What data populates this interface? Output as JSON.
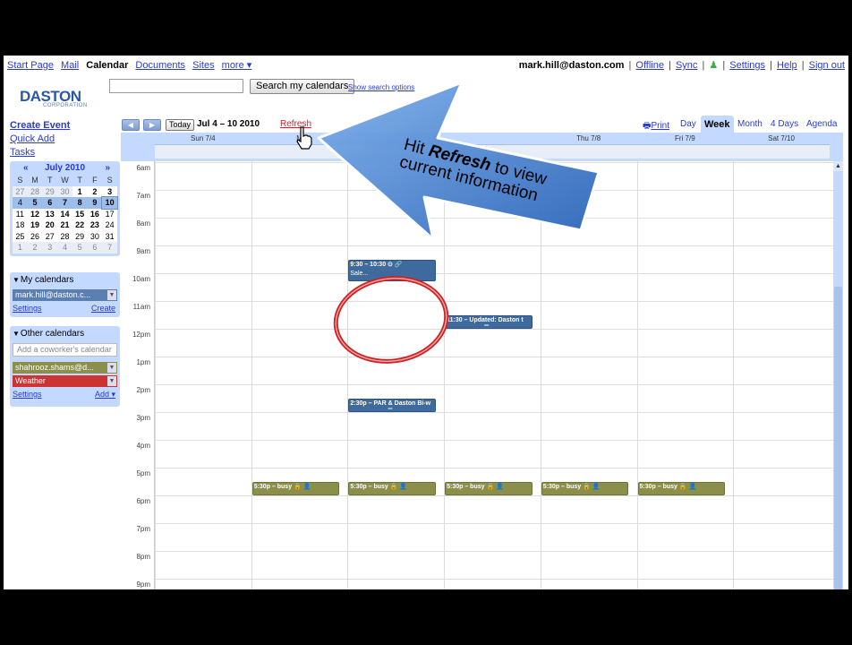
{
  "topnav": {
    "left": [
      {
        "label": "Start Page",
        "current": false
      },
      {
        "label": "Mail",
        "current": false
      },
      {
        "label": "Calendar",
        "current": true
      },
      {
        "label": "Documents",
        "current": false
      },
      {
        "label": "Sites",
        "current": false
      },
      {
        "label": "more ▾",
        "current": false
      }
    ],
    "email": "mark.hill@daston.com",
    "right": [
      "Offline",
      "Sync",
      "Settings",
      "Help",
      "Sign out"
    ]
  },
  "header": {
    "logo_text": "DASTON",
    "logo_sub": "CORPORATION",
    "search_button": "Search my calendars",
    "show_options": "Show search options"
  },
  "sidebar": {
    "create_event": "Create Event",
    "quick_add": "Quick Add",
    "tasks": "Tasks",
    "minical": {
      "month": "July 2010",
      "prev": "«",
      "next": "»",
      "weekdays": [
        "S",
        "M",
        "T",
        "W",
        "T",
        "F",
        "S"
      ],
      "weeks": [
        [
          "27",
          "28",
          "29",
          "30",
          "1",
          "2",
          "3"
        ],
        [
          "4",
          "5",
          "6",
          "7",
          "8",
          "9",
          "10"
        ],
        [
          "11",
          "12",
          "13",
          "14",
          "15",
          "16",
          "17"
        ],
        [
          "18",
          "19",
          "20",
          "21",
          "22",
          "23",
          "24"
        ],
        [
          "25",
          "26",
          "27",
          "28",
          "29",
          "30",
          "31"
        ],
        [
          "1",
          "2",
          "3",
          "4",
          "5",
          "6",
          "7"
        ]
      ]
    },
    "my_calendars": {
      "title": "My calendars",
      "items": [
        {
          "label": "mark.hill@daston.c...",
          "color": "#5a7fb0"
        }
      ],
      "settings": "Settings",
      "create": "Create"
    },
    "other_calendars": {
      "title": "Other calendars",
      "placeholder": "Add a coworker's calendar",
      "items": [
        {
          "label": "shahrooz.shams@d...",
          "color": "#8b8f4a"
        },
        {
          "label": "Weather",
          "color": "#cc3333"
        }
      ],
      "settings": "Settings",
      "add": "Add ▾"
    }
  },
  "toolbar": {
    "prev": "◀",
    "next": "▶",
    "today": "Today",
    "date_range": "Jul 4 – 10 2010",
    "refresh": "Refresh",
    "print": "Print",
    "views": [
      "Day",
      "Week",
      "Month",
      "4 Days",
      "Agenda"
    ],
    "active_view": "Week"
  },
  "grid": {
    "days": [
      "Sun 7/4",
      "M",
      "",
      "",
      "Thu 7/8",
      "Fri 7/9",
      "Sat 7/10"
    ],
    "hours": [
      "6am",
      "7am",
      "8am",
      "9am",
      "10am",
      "11am",
      "12pm",
      "1pm",
      "2pm",
      "3pm",
      "4pm",
      "5pm",
      "6pm",
      "7pm",
      "8pm",
      "9pm"
    ],
    "events": [
      {
        "label": "9:30 – 10:30 ⊙ 🔗",
        "sub": "Sale...",
        "day": 2,
        "start": 9.5,
        "end": 10.3,
        "kind": "blue"
      },
      {
        "label": "11:30 – Updated: Daston t",
        "sub": "",
        "day": 3,
        "start": 11.5,
        "end": 12.0,
        "kind": "blue"
      },
      {
        "label": "2:30p – PAR & Daston Bi-w",
        "sub": "",
        "day": 2,
        "start": 14.5,
        "end": 15.0,
        "kind": "blue"
      },
      {
        "label": "5:30p – busy 🔒 👤",
        "sub": "",
        "day": 1,
        "start": 17.5,
        "end": 18.0,
        "kind": "busy"
      },
      {
        "label": "5:30p – busy 🔒 👤",
        "sub": "",
        "day": 2,
        "start": 17.5,
        "end": 18.0,
        "kind": "busy"
      },
      {
        "label": "5:30p – busy 🔒 👤",
        "sub": "",
        "day": 3,
        "start": 17.5,
        "end": 18.0,
        "kind": "busy"
      },
      {
        "label": "5:30p – busy 🔒 👤",
        "sub": "",
        "day": 4,
        "start": 17.5,
        "end": 18.0,
        "kind": "busy"
      },
      {
        "label": "5:30p – busy 🔒 👤",
        "sub": "",
        "day": 5,
        "start": 17.5,
        "end": 18.0,
        "kind": "busy"
      }
    ]
  },
  "annotation": {
    "line1_pre": "Hit ",
    "line1_bold": "Refresh",
    "line1_post": " to view",
    "line2": "current information"
  },
  "colors": {
    "accent": "#c3d9ff",
    "link": "#2a3bcc",
    "arrow": "#3f7fcf",
    "circle": "#d02020"
  }
}
